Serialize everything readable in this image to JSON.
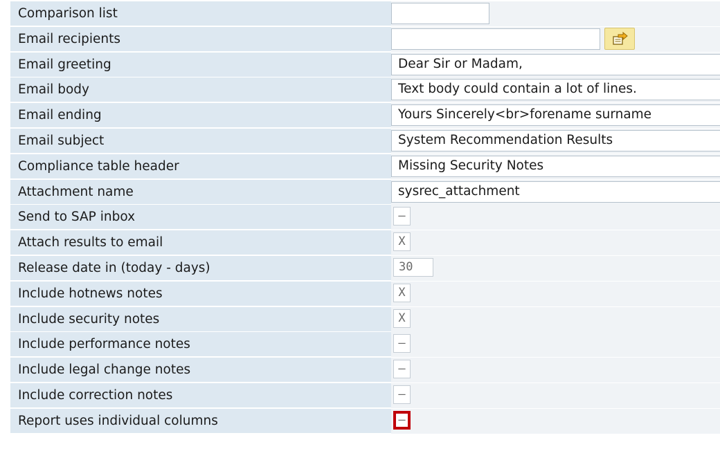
{
  "rows": [
    {
      "label": "Comparison list",
      "type": "text-short",
      "value": ""
    },
    {
      "label": "Email recipients",
      "type": "text-recip",
      "value": "",
      "button_icon": "multiple-selection-arrow-icon"
    },
    {
      "label": "Email greeting",
      "type": "text-wide",
      "value": "Dear Sir or Madam,"
    },
    {
      "label": "Email body",
      "type": "text-wide",
      "value": "Text body could contain a lot of lines."
    },
    {
      "label": "Email ending",
      "type": "text-wide",
      "value": "Yours Sincerely<br>forename surname"
    },
    {
      "label": "Email subject",
      "type": "text-wide",
      "value": "System Recommendation Results"
    },
    {
      "label": "Compliance table header",
      "type": "text-wide",
      "value": "Missing Security Notes"
    },
    {
      "label": "Attachment name",
      "type": "text-wide",
      "value": "sysrec_attachment"
    },
    {
      "label": "Send to SAP inbox",
      "type": "check",
      "value": "–"
    },
    {
      "label": "Attach results to email",
      "type": "check",
      "value": "X"
    },
    {
      "label": "Release date in (today - days)",
      "type": "number",
      "value": "30"
    },
    {
      "label": "Include hotnews notes",
      "type": "check",
      "value": "X"
    },
    {
      "label": "Include security notes",
      "type": "check",
      "value": "X"
    },
    {
      "label": "Include performance notes",
      "type": "check",
      "value": "–"
    },
    {
      "label": "Include legal change notes",
      "type": "check",
      "value": "–"
    },
    {
      "label": "Include correction notes",
      "type": "check",
      "value": "–"
    },
    {
      "label": "Report uses individual columns",
      "type": "check",
      "value": "–",
      "highlighted": true
    }
  ],
  "colors": {
    "label_background": "#dde8f1",
    "highlight_border": "#c0000b",
    "button_background": "#f6e8a0"
  }
}
